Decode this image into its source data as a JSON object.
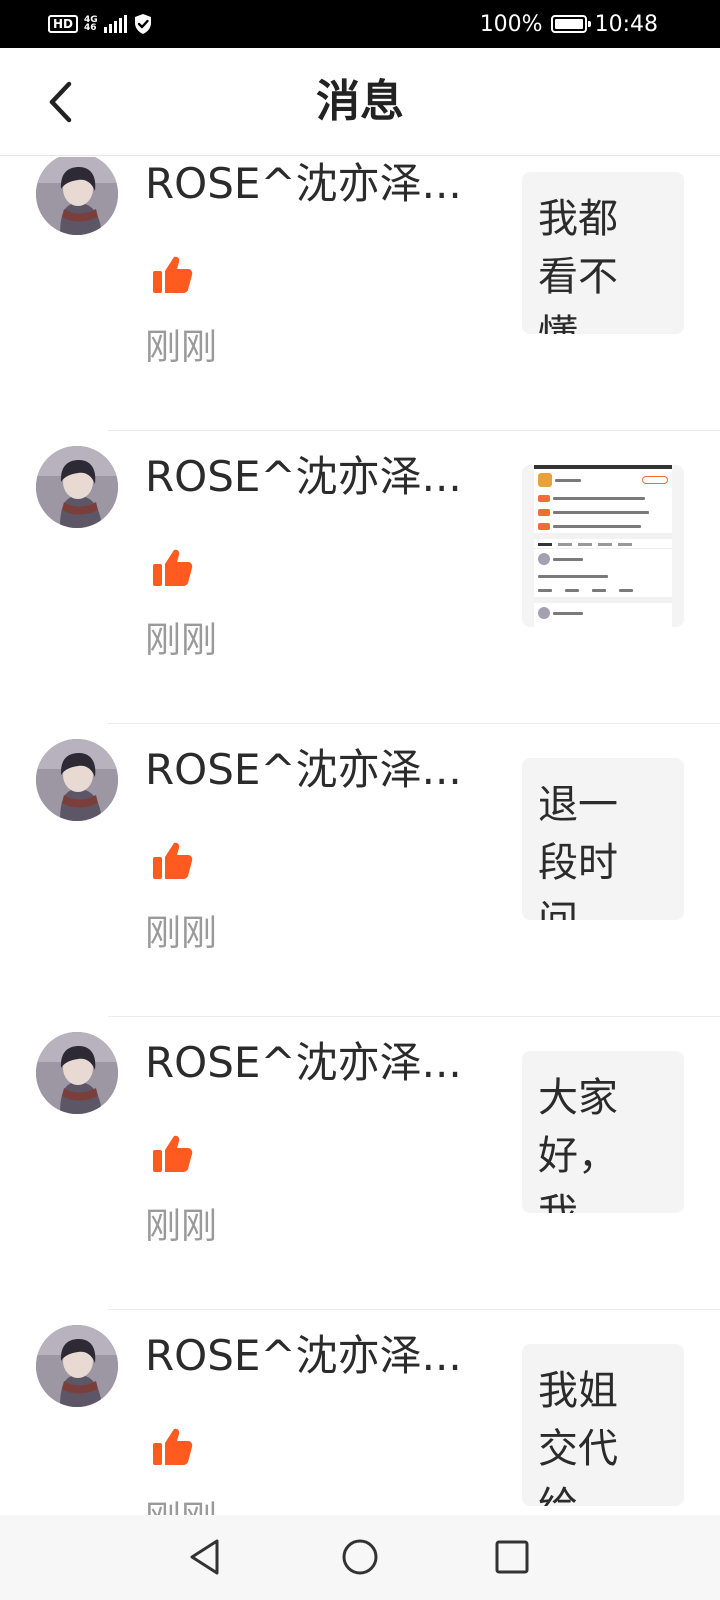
{
  "status_bar": {
    "hd": "HD",
    "network": "4G",
    "network_sub": "46",
    "battery": "100%",
    "battery_level": 1.0,
    "time": "10:48"
  },
  "header": {
    "title": "消息"
  },
  "notifications": [
    {
      "username": "ROSE^沈亦泽....",
      "time": "刚刚",
      "preview_text": "我都看不懂",
      "preview_type": "text",
      "icon": "thumbs-up-icon"
    },
    {
      "username": "ROSE^沈亦泽....",
      "time": "刚刚",
      "preview_text": "",
      "preview_type": "screenshot",
      "icon": "thumbs-up-icon"
    },
    {
      "username": "ROSE^沈亦泽....",
      "time": "刚刚",
      "preview_text": "退一段时间",
      "preview_type": "text",
      "icon": "thumbs-up-icon"
    },
    {
      "username": "ROSE^沈亦泽....",
      "time": "刚刚",
      "preview_text": "大家好，我",
      "preview_type": "text",
      "icon": "thumbs-up-icon"
    },
    {
      "username": "ROSE^沈亦泽....",
      "time": "刚刚",
      "preview_text": "我姐交代给",
      "preview_type": "text",
      "icon": "thumbs-up-icon"
    }
  ],
  "colors": {
    "accent": "#ff5a1f",
    "time_text": "#9a9a9a",
    "preview_bg": "#f4f4f4"
  },
  "nav": {
    "back_icon": "triangle-back-icon",
    "home_icon": "circle-home-icon",
    "recents_icon": "square-recents-icon"
  }
}
